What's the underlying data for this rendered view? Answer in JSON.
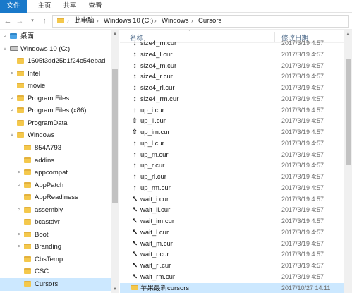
{
  "ribbon": {
    "tabs": [
      "文件",
      "主页",
      "共享",
      "查看"
    ]
  },
  "nav": {
    "back": "←",
    "forward": "→",
    "history": "▾",
    "up": "↑",
    "sep": "›",
    "breadcrumbs": [
      "此电脑",
      "Windows 10 (C:)",
      "Windows",
      "Cursors"
    ]
  },
  "tree": {
    "items": [
      {
        "label": "桌面",
        "icon": "folder-blue-icon",
        "expand": ">"
      },
      {
        "label": "Windows 10 (C:)",
        "icon": "drive-icon",
        "expand": "v"
      },
      {
        "label": "1605f3dd25b1f24c54ebad",
        "icon": "folder-icon",
        "expand": ""
      },
      {
        "label": "Intel",
        "icon": "folder-icon",
        "expand": ">"
      },
      {
        "label": "movie",
        "icon": "folder-icon",
        "expand": ""
      },
      {
        "label": "Program Files",
        "icon": "folder-icon",
        "expand": ">"
      },
      {
        "label": "Program Files (x86)",
        "icon": "folder-icon",
        "expand": ">"
      },
      {
        "label": "ProgramData",
        "icon": "folder-icon",
        "expand": ""
      },
      {
        "label": "Windows",
        "icon": "folder-icon",
        "expand": "v"
      },
      {
        "label": "854A793",
        "icon": "folder-icon",
        "expand": ""
      },
      {
        "label": "addins",
        "icon": "folder-icon",
        "expand": ""
      },
      {
        "label": "appcompat",
        "icon": "folder-icon",
        "expand": ">"
      },
      {
        "label": "AppPatch",
        "icon": "folder-icon",
        "expand": ">"
      },
      {
        "label": "AppReadiness",
        "icon": "folder-icon",
        "expand": ""
      },
      {
        "label": "assembly",
        "icon": "folder-icon",
        "expand": ">"
      },
      {
        "label": "bcastdvr",
        "icon": "folder-icon",
        "expand": ""
      },
      {
        "label": "Boot",
        "icon": "folder-icon",
        "expand": ">"
      },
      {
        "label": "Branding",
        "icon": "folder-icon",
        "expand": ">"
      },
      {
        "label": "CbsTemp",
        "icon": "folder-icon",
        "expand": ""
      },
      {
        "label": "CSC",
        "icon": "folder-icon",
        "expand": ""
      },
      {
        "label": "Cursors",
        "icon": "folder-icon",
        "expand": ""
      }
    ]
  },
  "list": {
    "header": {
      "name": "名称",
      "date": "修改日期",
      "sort": "^"
    },
    "rows": [
      {
        "icon": "↕",
        "name": "size4_m.cur",
        "date": "2017/3/19 4:57"
      },
      {
        "icon": "↕",
        "name": "size4_l.cur",
        "date": "2017/3/19 4:57"
      },
      {
        "icon": "↕",
        "name": "size4_m.cur",
        "date": "2017/3/19 4:57"
      },
      {
        "icon": "↕",
        "name": "size4_r.cur",
        "date": "2017/3/19 4:57"
      },
      {
        "icon": "↕",
        "name": "size4_rl.cur",
        "date": "2017/3/19 4:57"
      },
      {
        "icon": "↕",
        "name": "size4_rm.cur",
        "date": "2017/3/19 4:57"
      },
      {
        "icon": "↑",
        "name": "up_i.cur",
        "date": "2017/3/19 4:57"
      },
      {
        "icon": "⇧",
        "name": "up_il.cur",
        "date": "2017/3/19 4:57"
      },
      {
        "icon": "⇧",
        "name": "up_im.cur",
        "date": "2017/3/19 4:57"
      },
      {
        "icon": "↑",
        "name": "up_l.cur",
        "date": "2017/3/19 4:57"
      },
      {
        "icon": "↑",
        "name": "up_m.cur",
        "date": "2017/3/19 4:57"
      },
      {
        "icon": "↑",
        "name": "up_r.cur",
        "date": "2017/3/19 4:57"
      },
      {
        "icon": "↑",
        "name": "up_rl.cur",
        "date": "2017/3/19 4:57"
      },
      {
        "icon": "↑",
        "name": "up_rm.cur",
        "date": "2017/3/19 4:57"
      },
      {
        "icon": "↖",
        "name": "wait_i.cur",
        "date": "2017/3/19 4:57"
      },
      {
        "icon": "↖",
        "name": "wait_il.cur",
        "date": "2017/3/19 4:57"
      },
      {
        "icon": "↖",
        "name": "wait_im.cur",
        "date": "2017/3/19 4:57"
      },
      {
        "icon": "↖",
        "name": "wait_l.cur",
        "date": "2017/3/19 4:57"
      },
      {
        "icon": "↖",
        "name": "wait_m.cur",
        "date": "2017/3/19 4:57"
      },
      {
        "icon": "↖",
        "name": "wait_r.cur",
        "date": "2017/3/19 4:57"
      },
      {
        "icon": "↖",
        "name": "wait_rl.cur",
        "date": "2017/3/19 4:57"
      },
      {
        "icon": "↖",
        "name": "wait_rm.cur",
        "date": "2017/3/19 4:57"
      },
      {
        "icon": "folder",
        "name": "苹果最新cursors",
        "date": "2017/10/27 14:11"
      }
    ]
  },
  "scroll": {
    "up": "▲",
    "down": "▼"
  }
}
